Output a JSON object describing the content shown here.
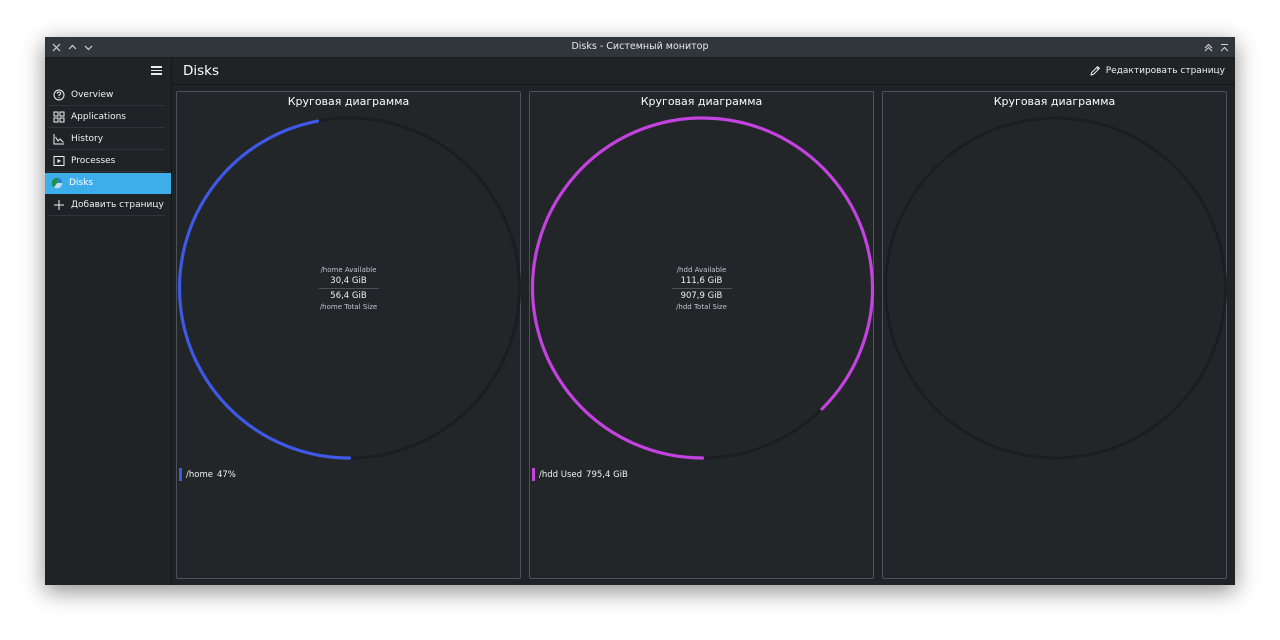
{
  "window": {
    "title": "Disks - Системный монитор"
  },
  "sidebar": {
    "items": [
      {
        "label": "Overview",
        "icon": "help-circle-icon",
        "active": false
      },
      {
        "label": "Applications",
        "icon": "app-grid-icon",
        "active": false
      },
      {
        "label": "History",
        "icon": "line-chart-icon",
        "active": false
      },
      {
        "label": "Processes",
        "icon": "process-icon",
        "active": false
      },
      {
        "label": "Disks",
        "icon": "disk-pie-icon",
        "active": true
      },
      {
        "label": "Добавить страницу",
        "icon": "plus-icon",
        "active": false
      }
    ]
  },
  "main": {
    "title": "Disks",
    "edit_label": "Редактировать страницу"
  },
  "colors": {
    "accent": "#3daee9",
    "home": "#3d59e6",
    "hdd": "#c342e0",
    "track": "#1b1d20"
  },
  "cards": [
    {
      "title": "Круговая диаграмма",
      "center": {
        "top_label": "/home Available",
        "value1": "30,4 GiB",
        "value2": "56,4 GiB",
        "bottom_label": "/home Total Size"
      },
      "legend": {
        "name": "/home",
        "value": "47%"
      }
    },
    {
      "title": "Круговая диаграмма",
      "center": {
        "top_label": "/hdd Available",
        "value1": "111,6 GiB",
        "value2": "907,9 GiB",
        "bottom_label": "/hdd Total Size"
      },
      "legend": {
        "name": "/hdd Used",
        "value": "795,4 GiB"
      }
    },
    {
      "title": "Круговая диаграмма"
    }
  ],
  "chart_data": [
    {
      "type": "pie",
      "title": "Круговая диаграмма",
      "series": [
        {
          "name": "/home",
          "fraction": 0.47,
          "color": "#3d59e6"
        }
      ]
    },
    {
      "type": "pie",
      "title": "Круговая диаграмма",
      "series": [
        {
          "name": "/hdd Used",
          "fraction": 0.876,
          "color": "#c342e0"
        }
      ]
    },
    {
      "type": "pie",
      "title": "Круговая диаграмма",
      "series": []
    }
  ]
}
